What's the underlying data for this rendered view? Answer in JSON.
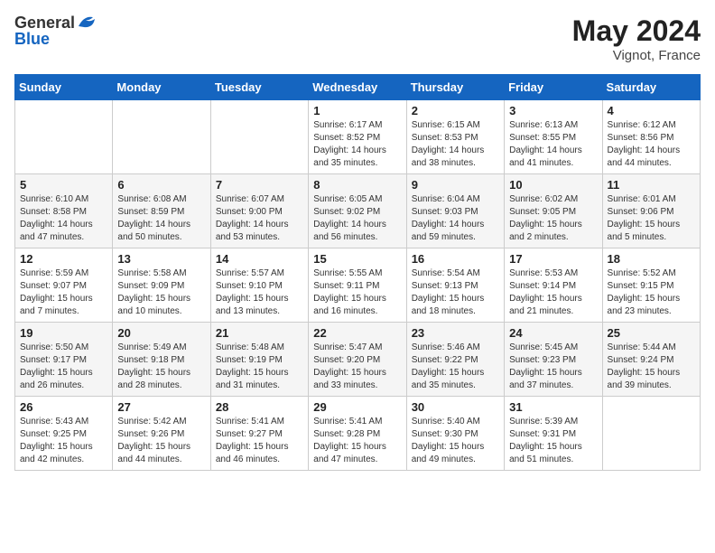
{
  "header": {
    "logo_general": "General",
    "logo_blue": "Blue",
    "month": "May 2024",
    "location": "Vignot, France"
  },
  "weekdays": [
    "Sunday",
    "Monday",
    "Tuesday",
    "Wednesday",
    "Thursday",
    "Friday",
    "Saturday"
  ],
  "weeks": [
    [
      {
        "day": "",
        "lines": []
      },
      {
        "day": "",
        "lines": []
      },
      {
        "day": "",
        "lines": []
      },
      {
        "day": "1",
        "lines": [
          "Sunrise: 6:17 AM",
          "Sunset: 8:52 PM",
          "Daylight: 14 hours",
          "and 35 minutes."
        ]
      },
      {
        "day": "2",
        "lines": [
          "Sunrise: 6:15 AM",
          "Sunset: 8:53 PM",
          "Daylight: 14 hours",
          "and 38 minutes."
        ]
      },
      {
        "day": "3",
        "lines": [
          "Sunrise: 6:13 AM",
          "Sunset: 8:55 PM",
          "Daylight: 14 hours",
          "and 41 minutes."
        ]
      },
      {
        "day": "4",
        "lines": [
          "Sunrise: 6:12 AM",
          "Sunset: 8:56 PM",
          "Daylight: 14 hours",
          "and 44 minutes."
        ]
      }
    ],
    [
      {
        "day": "5",
        "lines": [
          "Sunrise: 6:10 AM",
          "Sunset: 8:58 PM",
          "Daylight: 14 hours",
          "and 47 minutes."
        ]
      },
      {
        "day": "6",
        "lines": [
          "Sunrise: 6:08 AM",
          "Sunset: 8:59 PM",
          "Daylight: 14 hours",
          "and 50 minutes."
        ]
      },
      {
        "day": "7",
        "lines": [
          "Sunrise: 6:07 AM",
          "Sunset: 9:00 PM",
          "Daylight: 14 hours",
          "and 53 minutes."
        ]
      },
      {
        "day": "8",
        "lines": [
          "Sunrise: 6:05 AM",
          "Sunset: 9:02 PM",
          "Daylight: 14 hours",
          "and 56 minutes."
        ]
      },
      {
        "day": "9",
        "lines": [
          "Sunrise: 6:04 AM",
          "Sunset: 9:03 PM",
          "Daylight: 14 hours",
          "and 59 minutes."
        ]
      },
      {
        "day": "10",
        "lines": [
          "Sunrise: 6:02 AM",
          "Sunset: 9:05 PM",
          "Daylight: 15 hours",
          "and 2 minutes."
        ]
      },
      {
        "day": "11",
        "lines": [
          "Sunrise: 6:01 AM",
          "Sunset: 9:06 PM",
          "Daylight: 15 hours",
          "and 5 minutes."
        ]
      }
    ],
    [
      {
        "day": "12",
        "lines": [
          "Sunrise: 5:59 AM",
          "Sunset: 9:07 PM",
          "Daylight: 15 hours",
          "and 7 minutes."
        ]
      },
      {
        "day": "13",
        "lines": [
          "Sunrise: 5:58 AM",
          "Sunset: 9:09 PM",
          "Daylight: 15 hours",
          "and 10 minutes."
        ]
      },
      {
        "day": "14",
        "lines": [
          "Sunrise: 5:57 AM",
          "Sunset: 9:10 PM",
          "Daylight: 15 hours",
          "and 13 minutes."
        ]
      },
      {
        "day": "15",
        "lines": [
          "Sunrise: 5:55 AM",
          "Sunset: 9:11 PM",
          "Daylight: 15 hours",
          "and 16 minutes."
        ]
      },
      {
        "day": "16",
        "lines": [
          "Sunrise: 5:54 AM",
          "Sunset: 9:13 PM",
          "Daylight: 15 hours",
          "and 18 minutes."
        ]
      },
      {
        "day": "17",
        "lines": [
          "Sunrise: 5:53 AM",
          "Sunset: 9:14 PM",
          "Daylight: 15 hours",
          "and 21 minutes."
        ]
      },
      {
        "day": "18",
        "lines": [
          "Sunrise: 5:52 AM",
          "Sunset: 9:15 PM",
          "Daylight: 15 hours",
          "and 23 minutes."
        ]
      }
    ],
    [
      {
        "day": "19",
        "lines": [
          "Sunrise: 5:50 AM",
          "Sunset: 9:17 PM",
          "Daylight: 15 hours",
          "and 26 minutes."
        ]
      },
      {
        "day": "20",
        "lines": [
          "Sunrise: 5:49 AM",
          "Sunset: 9:18 PM",
          "Daylight: 15 hours",
          "and 28 minutes."
        ]
      },
      {
        "day": "21",
        "lines": [
          "Sunrise: 5:48 AM",
          "Sunset: 9:19 PM",
          "Daylight: 15 hours",
          "and 31 minutes."
        ]
      },
      {
        "day": "22",
        "lines": [
          "Sunrise: 5:47 AM",
          "Sunset: 9:20 PM",
          "Daylight: 15 hours",
          "and 33 minutes."
        ]
      },
      {
        "day": "23",
        "lines": [
          "Sunrise: 5:46 AM",
          "Sunset: 9:22 PM",
          "Daylight: 15 hours",
          "and 35 minutes."
        ]
      },
      {
        "day": "24",
        "lines": [
          "Sunrise: 5:45 AM",
          "Sunset: 9:23 PM",
          "Daylight: 15 hours",
          "and 37 minutes."
        ]
      },
      {
        "day": "25",
        "lines": [
          "Sunrise: 5:44 AM",
          "Sunset: 9:24 PM",
          "Daylight: 15 hours",
          "and 39 minutes."
        ]
      }
    ],
    [
      {
        "day": "26",
        "lines": [
          "Sunrise: 5:43 AM",
          "Sunset: 9:25 PM",
          "Daylight: 15 hours",
          "and 42 minutes."
        ]
      },
      {
        "day": "27",
        "lines": [
          "Sunrise: 5:42 AM",
          "Sunset: 9:26 PM",
          "Daylight: 15 hours",
          "and 44 minutes."
        ]
      },
      {
        "day": "28",
        "lines": [
          "Sunrise: 5:41 AM",
          "Sunset: 9:27 PM",
          "Daylight: 15 hours",
          "and 46 minutes."
        ]
      },
      {
        "day": "29",
        "lines": [
          "Sunrise: 5:41 AM",
          "Sunset: 9:28 PM",
          "Daylight: 15 hours",
          "and 47 minutes."
        ]
      },
      {
        "day": "30",
        "lines": [
          "Sunrise: 5:40 AM",
          "Sunset: 9:30 PM",
          "Daylight: 15 hours",
          "and 49 minutes."
        ]
      },
      {
        "day": "31",
        "lines": [
          "Sunrise: 5:39 AM",
          "Sunset: 9:31 PM",
          "Daylight: 15 hours",
          "and 51 minutes."
        ]
      },
      {
        "day": "",
        "lines": []
      }
    ]
  ]
}
